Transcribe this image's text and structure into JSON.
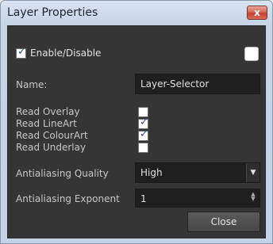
{
  "window": {
    "title": "Layer Properties",
    "close_glyph": "x"
  },
  "dialog": {
    "enable_label": "Enable/Disable",
    "enable_checked": true,
    "layer_color": "#ffffff",
    "name_label": "Name:",
    "name_value": "Layer-Selector",
    "read_options": [
      {
        "label": "Read Overlay",
        "checked": false
      },
      {
        "label": "Read LineArt",
        "checked": true
      },
      {
        "label": "Read ColourArt",
        "checked": true
      },
      {
        "label": "Read Underlay",
        "checked": false
      }
    ],
    "aa_quality_label": "Antialiasing Quality",
    "aa_quality_value": "High",
    "aa_exponent_label": "Antialiasing Exponent",
    "aa_exponent_value": "1",
    "close_label": "Close"
  },
  "glyphs": {
    "check": "✓",
    "dropdown": "▼",
    "spin_up": "▲",
    "spin_down": "▼"
  },
  "icons": [
    "close-icon",
    "checkmark-icon",
    "dropdown-arrow-icon",
    "spinner-arrows-icon"
  ]
}
